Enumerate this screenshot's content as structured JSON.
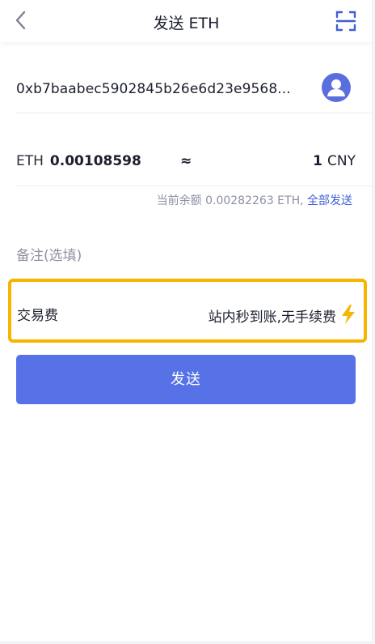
{
  "header": {
    "title": "发送 ETH",
    "back_icon": "chevron-left-icon",
    "scan_icon": "scan-icon"
  },
  "recipient": {
    "address": "0xb7baabec5902845b26e6d23e9568...",
    "avatar_icon": "user-avatar-icon"
  },
  "amount": {
    "currency": "ETH",
    "value": "0.00108598",
    "approx_symbol": "≈",
    "fiat_value": "1",
    "fiat_currency": "CNY"
  },
  "balance": {
    "text": "当前余额 0.00282263 ETH,",
    "send_all_label": "全部发送"
  },
  "memo": {
    "placeholder": "备注(选填)"
  },
  "fee": {
    "label": "交易费",
    "value": "站内秒到账,无手续费",
    "icon": "lightning-icon",
    "highlight_color": "#f5b500"
  },
  "actions": {
    "send_label": "发送"
  },
  "colors": {
    "accent": "#5672e6",
    "link": "#3e5fd6",
    "muted_text": "#8c90a3"
  }
}
